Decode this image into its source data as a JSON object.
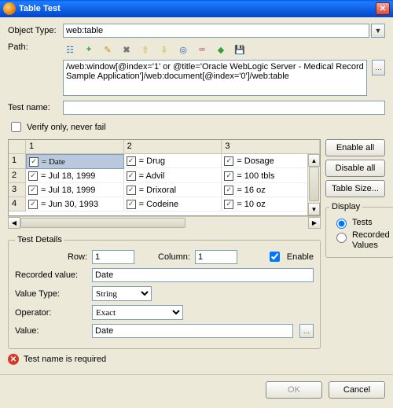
{
  "title": "Table Test",
  "labels": {
    "objectType": "Object Type:",
    "path": "Path:",
    "testName": "Test name:",
    "verify": "Verify only, never fail",
    "row": "Row:",
    "column": "Column:",
    "enable": "Enable",
    "recorded": "Recorded value:",
    "valueType": "Value Type:",
    "operator": "Operator:",
    "value": "Value:",
    "testDetails": "Test Details",
    "display": "Display"
  },
  "objectType": "web:table",
  "pathText": "/web:window[@index='1' or @title='Oracle WebLogic Server - Medical Record Sample Application']/web:document[@index='0']/web:table",
  "testName": "",
  "verifyChecked": false,
  "toolbar": [
    "tree-icon",
    "plus-icon",
    "pencil-icon",
    "delete-icon",
    "up-icon",
    "down-icon",
    "target-icon",
    "goggles-icon",
    "cube-icon",
    "save-icon"
  ],
  "grid": {
    "headers": [
      "",
      "1",
      "2",
      "3"
    ],
    "rows": [
      {
        "n": "1",
        "c1": "= Date",
        "c2": "= Drug",
        "c3": "= Dosage",
        "sel": true
      },
      {
        "n": "2",
        "c1": "= Jul 18, 1999",
        "c2": "= Advil",
        "c3": "= 100 tbls"
      },
      {
        "n": "3",
        "c1": "= Jul 18, 1999",
        "c2": "= Drixoral",
        "c3": "= 16 oz"
      },
      {
        "n": "4",
        "c1": "= Jun 30, 1993",
        "c2": "= Codeine",
        "c3": "= 10 oz"
      }
    ]
  },
  "sideButtons": {
    "enableAll": "Enable all",
    "disableAll": "Disable all",
    "tableSize": "Table Size..."
  },
  "displayGroup": {
    "tests": "Tests",
    "recorded": "Recorded Values",
    "selected": "tests"
  },
  "details": {
    "row": "1",
    "column": "1",
    "enable": true,
    "recordedValue": "Date",
    "valueType": "String",
    "operator": "Exact",
    "value": "Date"
  },
  "error": "Test name is required",
  "footer": {
    "ok": "OK",
    "cancel": "Cancel"
  }
}
